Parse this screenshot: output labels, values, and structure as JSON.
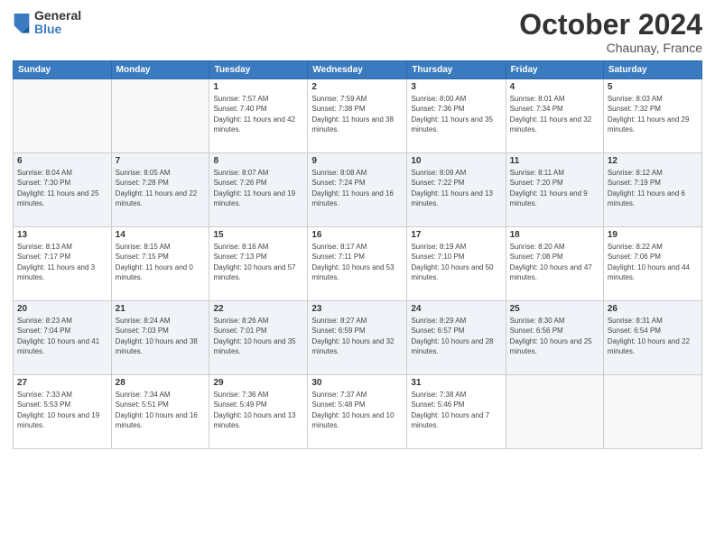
{
  "logo": {
    "general": "General",
    "blue": "Blue"
  },
  "title": "October 2024",
  "location": "Chaunay, France",
  "headers": [
    "Sunday",
    "Monday",
    "Tuesday",
    "Wednesday",
    "Thursday",
    "Friday",
    "Saturday"
  ],
  "weeks": [
    [
      {
        "day": "",
        "info": ""
      },
      {
        "day": "",
        "info": ""
      },
      {
        "day": "1",
        "info": "Sunrise: 7:57 AM\nSunset: 7:40 PM\nDaylight: 11 hours and 42 minutes."
      },
      {
        "day": "2",
        "info": "Sunrise: 7:59 AM\nSunset: 7:38 PM\nDaylight: 11 hours and 38 minutes."
      },
      {
        "day": "3",
        "info": "Sunrise: 8:00 AM\nSunset: 7:36 PM\nDaylight: 11 hours and 35 minutes."
      },
      {
        "day": "4",
        "info": "Sunrise: 8:01 AM\nSunset: 7:34 PM\nDaylight: 11 hours and 32 minutes."
      },
      {
        "day": "5",
        "info": "Sunrise: 8:03 AM\nSunset: 7:32 PM\nDaylight: 11 hours and 29 minutes."
      }
    ],
    [
      {
        "day": "6",
        "info": "Sunrise: 8:04 AM\nSunset: 7:30 PM\nDaylight: 11 hours and 25 minutes."
      },
      {
        "day": "7",
        "info": "Sunrise: 8:05 AM\nSunset: 7:28 PM\nDaylight: 11 hours and 22 minutes."
      },
      {
        "day": "8",
        "info": "Sunrise: 8:07 AM\nSunset: 7:26 PM\nDaylight: 11 hours and 19 minutes."
      },
      {
        "day": "9",
        "info": "Sunrise: 8:08 AM\nSunset: 7:24 PM\nDaylight: 11 hours and 16 minutes."
      },
      {
        "day": "10",
        "info": "Sunrise: 8:09 AM\nSunset: 7:22 PM\nDaylight: 11 hours and 13 minutes."
      },
      {
        "day": "11",
        "info": "Sunrise: 8:11 AM\nSunset: 7:20 PM\nDaylight: 11 hours and 9 minutes."
      },
      {
        "day": "12",
        "info": "Sunrise: 8:12 AM\nSunset: 7:19 PM\nDaylight: 11 hours and 6 minutes."
      }
    ],
    [
      {
        "day": "13",
        "info": "Sunrise: 8:13 AM\nSunset: 7:17 PM\nDaylight: 11 hours and 3 minutes."
      },
      {
        "day": "14",
        "info": "Sunrise: 8:15 AM\nSunset: 7:15 PM\nDaylight: 11 hours and 0 minutes."
      },
      {
        "day": "15",
        "info": "Sunrise: 8:16 AM\nSunset: 7:13 PM\nDaylight: 10 hours and 57 minutes."
      },
      {
        "day": "16",
        "info": "Sunrise: 8:17 AM\nSunset: 7:11 PM\nDaylight: 10 hours and 53 minutes."
      },
      {
        "day": "17",
        "info": "Sunrise: 8:19 AM\nSunset: 7:10 PM\nDaylight: 10 hours and 50 minutes."
      },
      {
        "day": "18",
        "info": "Sunrise: 8:20 AM\nSunset: 7:08 PM\nDaylight: 10 hours and 47 minutes."
      },
      {
        "day": "19",
        "info": "Sunrise: 8:22 AM\nSunset: 7:06 PM\nDaylight: 10 hours and 44 minutes."
      }
    ],
    [
      {
        "day": "20",
        "info": "Sunrise: 8:23 AM\nSunset: 7:04 PM\nDaylight: 10 hours and 41 minutes."
      },
      {
        "day": "21",
        "info": "Sunrise: 8:24 AM\nSunset: 7:03 PM\nDaylight: 10 hours and 38 minutes."
      },
      {
        "day": "22",
        "info": "Sunrise: 8:26 AM\nSunset: 7:01 PM\nDaylight: 10 hours and 35 minutes."
      },
      {
        "day": "23",
        "info": "Sunrise: 8:27 AM\nSunset: 6:59 PM\nDaylight: 10 hours and 32 minutes."
      },
      {
        "day": "24",
        "info": "Sunrise: 8:29 AM\nSunset: 6:57 PM\nDaylight: 10 hours and 28 minutes."
      },
      {
        "day": "25",
        "info": "Sunrise: 8:30 AM\nSunset: 6:56 PM\nDaylight: 10 hours and 25 minutes."
      },
      {
        "day": "26",
        "info": "Sunrise: 8:31 AM\nSunset: 6:54 PM\nDaylight: 10 hours and 22 minutes."
      }
    ],
    [
      {
        "day": "27",
        "info": "Sunrise: 7:33 AM\nSunset: 5:53 PM\nDaylight: 10 hours and 19 minutes."
      },
      {
        "day": "28",
        "info": "Sunrise: 7:34 AM\nSunset: 5:51 PM\nDaylight: 10 hours and 16 minutes."
      },
      {
        "day": "29",
        "info": "Sunrise: 7:36 AM\nSunset: 5:49 PM\nDaylight: 10 hours and 13 minutes."
      },
      {
        "day": "30",
        "info": "Sunrise: 7:37 AM\nSunset: 5:48 PM\nDaylight: 10 hours and 10 minutes."
      },
      {
        "day": "31",
        "info": "Sunrise: 7:38 AM\nSunset: 5:46 PM\nDaylight: 10 hours and 7 minutes."
      },
      {
        "day": "",
        "info": ""
      },
      {
        "day": "",
        "info": ""
      }
    ]
  ]
}
